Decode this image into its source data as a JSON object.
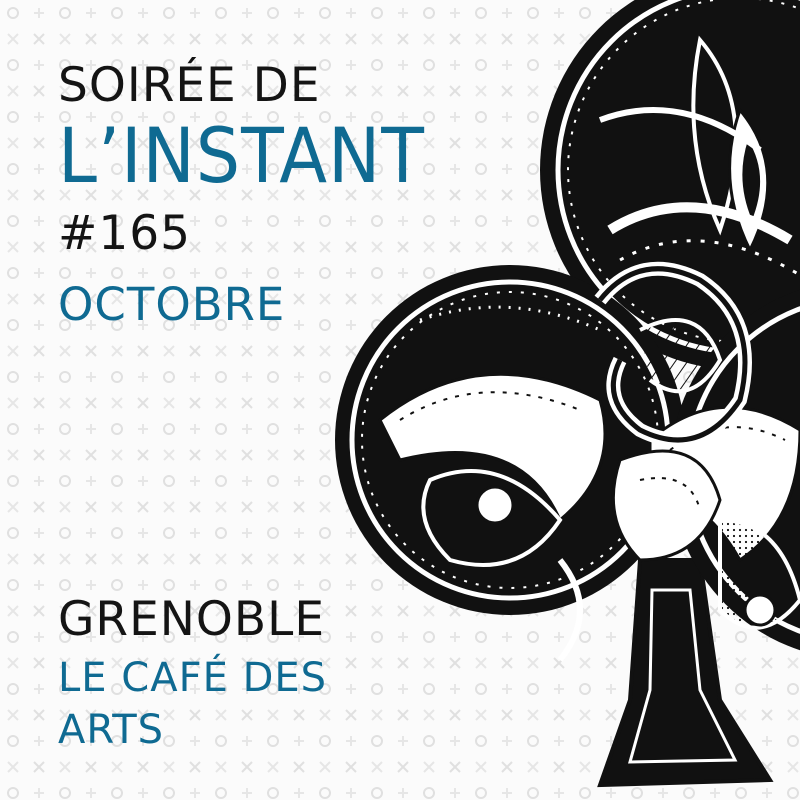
{
  "poster": {
    "line1": "SOIRÉE DE",
    "line2": "L’INSTANT",
    "line3": "#165",
    "line4": "OCTOBRE",
    "line5": "GRENOBLE",
    "line6a": "LE CAFÉ DES",
    "line6b": "ARTS"
  },
  "colors": {
    "accent": "#0f6a92",
    "text": "#141414",
    "background": "#fbfbfb",
    "pattern": "#e0e0e0"
  },
  "illustration": {
    "icon": "club-suit-zentangle-icon"
  }
}
